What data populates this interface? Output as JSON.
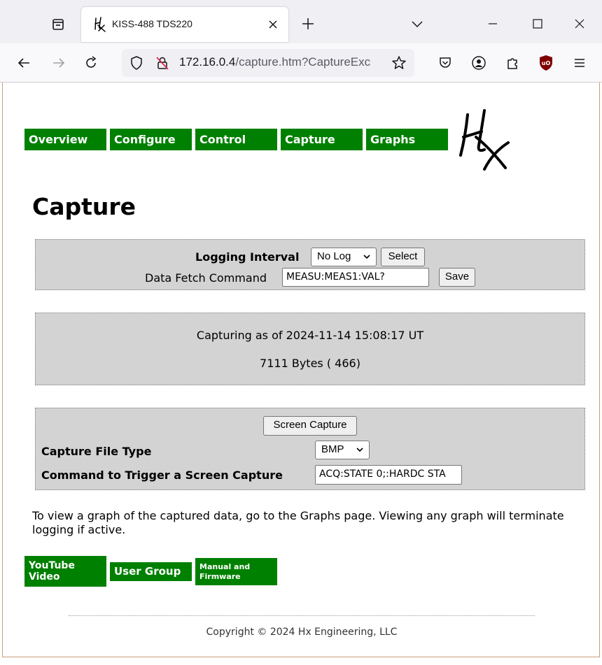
{
  "browser": {
    "tab": {
      "title": "KISS-488 TDS220"
    },
    "url": {
      "host": "172.16.0.4",
      "path": "/capture.htm?CaptureExc"
    },
    "colors": {
      "ublock": "#800000"
    }
  },
  "nav": {
    "links": [
      {
        "label": "Overview"
      },
      {
        "label": "Configure"
      },
      {
        "label": "Control"
      },
      {
        "label": "Capture"
      },
      {
        "label": "Graphs"
      }
    ]
  },
  "page": {
    "title": "Capture"
  },
  "logging": {
    "interval_label": "Logging Interval",
    "interval_value": "No Log",
    "select_button": "Select",
    "fetch_label": "Data Fetch Command",
    "fetch_value": "MEASU:MEAS1:VAL?",
    "save_button": "Save"
  },
  "status": {
    "capturing": "Capturing as of 2024-11-14 15:08:17 UT",
    "bytes": "7111 Bytes ( 466)"
  },
  "screen_capture": {
    "button": "Screen Capture",
    "file_type_label": "Capture File Type",
    "file_type_value": "BMP",
    "trigger_label": "Command to Trigger a Screen Capture",
    "trigger_value": "ACQ:STATE 0;:HARDC STA"
  },
  "info_text": "To view a graph of the captured data, go to the Graphs page. Viewing any graph will terminate logging if active.",
  "bottom_links": {
    "youtube": "YouTube Video",
    "user_group": "User Group",
    "manual": "Manual and Firmware"
  },
  "footer": {
    "copyright": "Copyright © 2024 Hx Engineering, LLC"
  },
  "colors": {
    "nav_green": "#008000",
    "panel_gray": "#d3d3d3"
  }
}
